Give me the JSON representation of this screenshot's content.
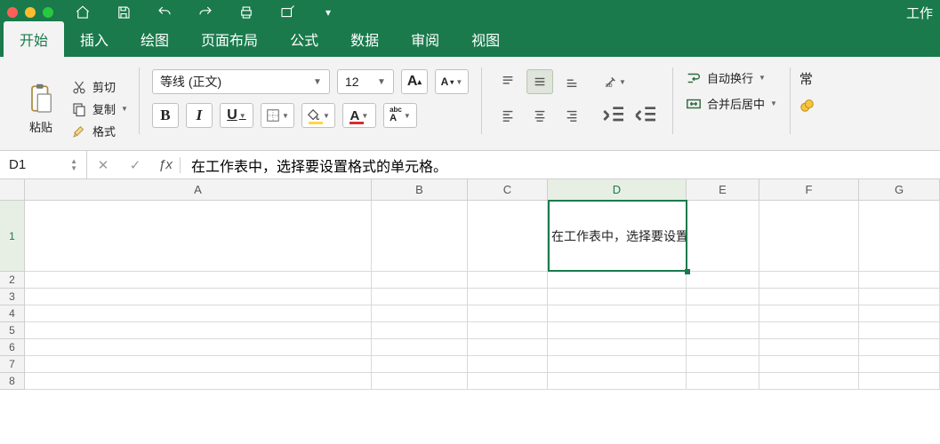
{
  "app_title": "工作",
  "qat_icons": [
    "home",
    "save",
    "undo",
    "redo",
    "print",
    "draw",
    "more"
  ],
  "tabs": [
    "开始",
    "插入",
    "绘图",
    "页面布局",
    "公式",
    "数据",
    "审阅",
    "视图"
  ],
  "active_tab": 0,
  "clipboard": {
    "paste_label": "粘贴",
    "cut_label": "剪切",
    "copy_label": "复制",
    "format_label": "格式"
  },
  "font": {
    "font_name": "等线 (正文)",
    "font_size": "12",
    "increase_label": "A",
    "decrease_label": "A",
    "bold": "B",
    "italic": "I",
    "underline": "U",
    "ruby_label": "abc"
  },
  "align": {
    "wrap_label": "自动换行",
    "merge_label": "合并后居中"
  },
  "number": {
    "general_label": "常"
  },
  "namebox": "D1",
  "formula": "在工作表中，选择要设置格式的单元格。",
  "columns": [
    "A",
    "B",
    "C",
    "D",
    "E",
    "F",
    "G"
  ],
  "rows": [
    "1",
    "2",
    "3",
    "4",
    "5",
    "6",
    "7",
    "8"
  ],
  "cell_D1": "在工作表中，选择要设置格式的单元格。在\"开始\"选项",
  "selected_col": "D",
  "selected_row": "1"
}
